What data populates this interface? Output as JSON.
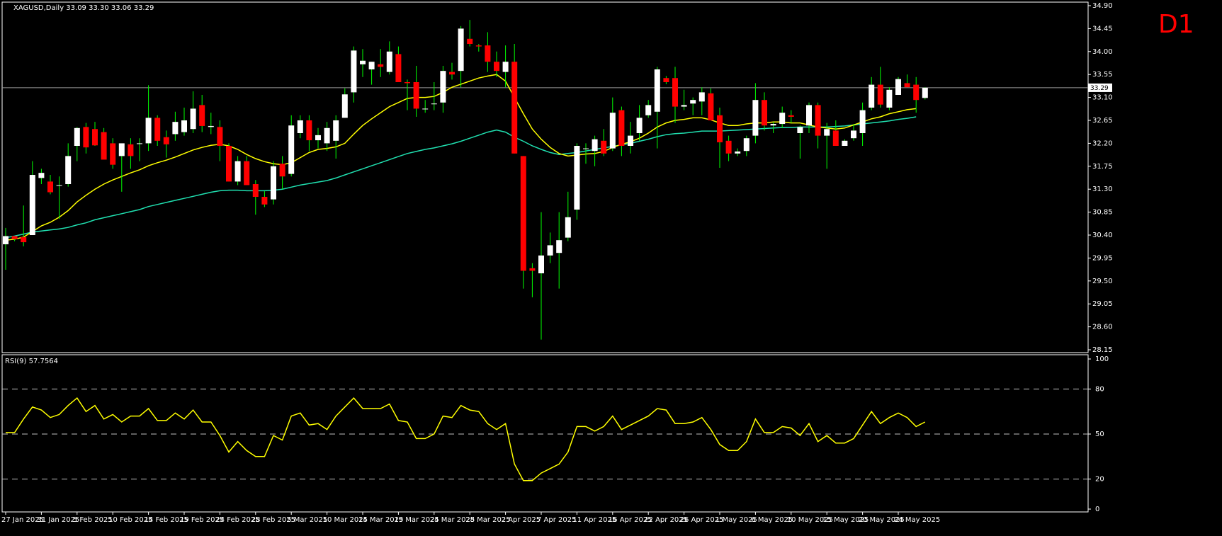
{
  "chart_data": [
    {
      "type": "candlestick",
      "symbol_line": "XAGUSD,Daily  33.09 33.30 33.06 33.29",
      "timeframe_label": "D1",
      "current_price_label": "33.29",
      "current_price": 33.29,
      "ylim": [
        28.15,
        34.9
      ],
      "y_ticks": [
        "34.90",
        "34.45",
        "34.00",
        "33.55",
        "33.10",
        "32.65",
        "32.20",
        "31.75",
        "31.30",
        "30.85",
        "30.40",
        "29.95",
        "29.50",
        "29.05",
        "28.60",
        "28.15"
      ],
      "x_ticks": [
        "27 Jan 2025",
        "31 Jan 2025",
        "5 Feb 2025",
        "10 Feb 2025",
        "14 Feb 2025",
        "19 Feb 2025",
        "24 Feb 2025",
        "28 Feb 2025",
        "5 Mar 2025",
        "10 Mar 2025",
        "14 Mar 2025",
        "19 Mar 2025",
        "24 Mar 2025",
        "28 Mar 2025",
        "2 Apr 2025",
        "7 Apr 2025",
        "11 Apr 2025",
        "16 Apr 2025",
        "22 Apr 2025",
        "26 Apr 2025",
        "1 May 2025",
        "6 May 2025",
        "10 May 2025",
        "15 May 2025",
        "20 May 2025",
        "24 May 2025"
      ],
      "colors": {
        "bull": "#ffffff",
        "bear": "#ff0000",
        "wick": "#00ff00",
        "ma_fast": "#ffff00",
        "ma_slow": "#20e0b0"
      },
      "candles": [
        [
          30.22,
          30.54,
          29.72,
          30.38
        ],
        [
          30.38,
          30.38,
          30.28,
          30.32
        ],
        [
          30.36,
          30.98,
          30.18,
          30.26
        ],
        [
          30.4,
          31.85,
          30.4,
          31.58
        ],
        [
          31.52,
          31.7,
          31.4,
          31.62
        ],
        [
          31.45,
          31.58,
          31.2,
          31.24
        ],
        [
          31.38,
          31.55,
          30.72,
          31.38
        ],
        [
          31.4,
          32.2,
          31.35,
          31.95
        ],
        [
          32.15,
          32.52,
          31.85,
          32.5
        ],
        [
          32.52,
          32.6,
          32.0,
          32.12
        ],
        [
          32.48,
          32.62,
          32.15,
          32.16
        ],
        [
          32.42,
          32.5,
          31.9,
          31.88
        ],
        [
          32.2,
          32.3,
          31.7,
          31.78
        ],
        [
          31.95,
          32.1,
          31.25,
          32.2
        ],
        [
          32.18,
          32.3,
          31.7,
          31.95
        ],
        [
          32.2,
          32.3,
          31.85,
          32.2
        ],
        [
          32.2,
          33.34,
          32.05,
          32.7
        ],
        [
          32.7,
          32.75,
          32.15,
          32.25
        ],
        [
          32.32,
          32.45,
          31.92,
          32.18
        ],
        [
          32.38,
          32.82,
          32.25,
          32.62
        ],
        [
          32.42,
          32.9,
          32.35,
          32.65
        ],
        [
          32.48,
          33.22,
          32.4,
          32.88
        ],
        [
          32.95,
          33.15,
          32.42,
          32.54
        ],
        [
          32.52,
          32.8,
          32.38,
          32.54
        ],
        [
          32.52,
          32.65,
          31.85,
          32.15
        ],
        [
          32.15,
          32.2,
          31.45,
          31.45
        ],
        [
          31.45,
          31.95,
          31.38,
          31.85
        ],
        [
          31.85,
          31.95,
          31.4,
          31.38
        ],
        [
          31.4,
          31.48,
          30.8,
          31.15
        ],
        [
          31.15,
          31.26,
          30.95,
          31.0
        ],
        [
          31.1,
          31.85,
          31.0,
          31.75
        ],
        [
          31.8,
          31.95,
          31.3,
          31.55
        ],
        [
          31.6,
          32.75,
          31.55,
          32.55
        ],
        [
          32.4,
          32.75,
          32.3,
          32.65
        ],
        [
          32.65,
          32.75,
          32.05,
          32.26
        ],
        [
          32.26,
          32.5,
          32.1,
          32.36
        ],
        [
          32.2,
          32.62,
          32.05,
          32.5
        ],
        [
          32.25,
          32.75,
          31.9,
          32.65
        ],
        [
          32.7,
          33.28,
          32.7,
          33.16
        ],
        [
          33.2,
          34.1,
          33.0,
          34.02
        ],
        [
          33.75,
          34.05,
          33.5,
          33.82
        ],
        [
          33.65,
          33.8,
          33.35,
          33.8
        ],
        [
          33.75,
          34.05,
          33.5,
          33.7
        ],
        [
          33.6,
          34.2,
          33.55,
          34.0
        ],
        [
          33.95,
          34.1,
          33.4,
          33.4
        ],
        [
          33.4,
          33.45,
          32.85,
          33.38
        ],
        [
          33.4,
          33.72,
          32.72,
          32.88
        ],
        [
          32.88,
          33.05,
          32.8,
          32.88
        ],
        [
          32.98,
          33.4,
          32.85,
          32.98
        ],
        [
          33.0,
          33.72,
          32.8,
          33.62
        ],
        [
          33.6,
          33.78,
          33.45,
          33.55
        ],
        [
          33.62,
          34.5,
          33.3,
          34.45
        ],
        [
          34.25,
          34.62,
          34.1,
          34.15
        ],
        [
          34.12,
          34.15,
          34.0,
          34.1
        ],
        [
          34.12,
          34.38,
          33.6,
          33.8
        ],
        [
          33.8,
          34.0,
          33.5,
          33.62
        ],
        [
          33.6,
          34.12,
          33.3,
          33.8
        ],
        [
          33.8,
          34.15,
          32.0,
          32.0
        ],
        [
          31.95,
          31.95,
          29.35,
          29.7
        ],
        [
          29.75,
          29.85,
          29.18,
          29.7
        ],
        [
          29.65,
          30.85,
          28.35,
          30.0
        ],
        [
          30.0,
          30.45,
          29.85,
          30.2
        ],
        [
          30.05,
          30.85,
          29.35,
          30.3
        ],
        [
          30.35,
          31.25,
          30.28,
          30.75
        ],
        [
          30.9,
          32.2,
          30.7,
          32.15
        ],
        [
          32.1,
          32.2,
          31.8,
          32.1
        ],
        [
          32.05,
          32.35,
          31.75,
          32.28
        ],
        [
          32.25,
          32.48,
          31.95,
          32.0
        ],
        [
          32.1,
          33.1,
          32.05,
          32.8
        ],
        [
          32.85,
          32.92,
          31.95,
          32.15
        ],
        [
          32.15,
          32.62,
          32.0,
          32.35
        ],
        [
          32.4,
          32.95,
          32.25,
          32.7
        ],
        [
          32.75,
          33.05,
          32.7,
          32.95
        ],
        [
          32.82,
          33.7,
          32.1,
          33.65
        ],
        [
          33.48,
          33.52,
          33.36,
          33.4
        ],
        [
          33.48,
          33.7,
          32.6,
          32.92
        ],
        [
          32.92,
          33.25,
          32.85,
          32.95
        ],
        [
          32.98,
          33.1,
          32.75,
          33.05
        ],
        [
          33.02,
          33.3,
          32.75,
          33.2
        ],
        [
          33.18,
          33.28,
          32.65,
          32.65
        ],
        [
          32.75,
          32.9,
          31.72,
          32.22
        ],
        [
          32.25,
          32.35,
          31.85,
          32.0
        ],
        [
          32.0,
          32.1,
          31.95,
          32.04
        ],
        [
          32.05,
          32.35,
          31.95,
          32.3
        ],
        [
          32.35,
          33.38,
          32.2,
          33.05
        ],
        [
          33.05,
          33.2,
          32.45,
          32.55
        ],
        [
          32.55,
          32.62,
          32.4,
          32.58
        ],
        [
          32.58,
          32.92,
          32.5,
          32.8
        ],
        [
          32.75,
          32.85,
          32.6,
          32.72
        ],
        [
          32.4,
          32.55,
          31.9,
          32.52
        ],
        [
          32.55,
          33.0,
          32.4,
          32.95
        ],
        [
          32.95,
          33.0,
          32.1,
          32.35
        ],
        [
          32.35,
          32.6,
          31.7,
          32.48
        ],
        [
          32.45,
          32.65,
          32.15,
          32.15
        ],
        [
          32.15,
          32.28,
          32.2,
          32.25
        ],
        [
          32.3,
          32.58,
          32.25,
          32.45
        ],
        [
          32.4,
          33.0,
          32.15,
          32.85
        ],
        [
          32.9,
          33.5,
          32.85,
          33.35
        ],
        [
          33.35,
          33.7,
          32.9,
          32.96
        ],
        [
          32.9,
          33.3,
          32.85,
          33.25
        ],
        [
          33.15,
          33.5,
          33.15,
          33.46
        ],
        [
          33.38,
          33.55,
          33.3,
          33.3
        ],
        [
          33.35,
          33.5,
          32.8,
          33.05
        ],
        [
          33.09,
          33.3,
          33.06,
          33.29
        ]
      ],
      "ma_fast": [
        30.3,
        30.32,
        30.36,
        30.47,
        30.58,
        30.65,
        30.75,
        30.88,
        31.05,
        31.18,
        31.3,
        31.4,
        31.48,
        31.55,
        31.62,
        31.68,
        31.76,
        31.82,
        31.87,
        31.93,
        32.0,
        32.07,
        32.12,
        32.16,
        32.18,
        32.15,
        32.08,
        31.98,
        31.9,
        31.84,
        31.8,
        31.78,
        31.82,
        31.92,
        32.02,
        32.08,
        32.1,
        32.13,
        32.2,
        32.38,
        32.55,
        32.68,
        32.8,
        32.92,
        33.0,
        33.08,
        33.1,
        33.1,
        33.12,
        33.2,
        33.3,
        33.36,
        33.42,
        33.48,
        33.52,
        33.55,
        33.42,
        33.1,
        32.78,
        32.48,
        32.28,
        32.12,
        32.0,
        31.95,
        31.97,
        31.99,
        32.0,
        32.04,
        32.12,
        32.18,
        32.23,
        32.3,
        32.4,
        32.52,
        32.6,
        32.65,
        32.67,
        32.7,
        32.7,
        32.66,
        32.6,
        32.55,
        32.55,
        32.58,
        32.6,
        32.6,
        32.62,
        32.62,
        32.6,
        32.6,
        32.56,
        32.52,
        32.5,
        32.48,
        32.5,
        32.56,
        32.62,
        32.68,
        32.72,
        32.78,
        32.82,
        32.86,
        32.88
      ],
      "ma_slow": [
        30.35,
        30.38,
        30.42,
        30.46,
        30.48,
        30.5,
        30.52,
        30.55,
        30.6,
        30.64,
        30.7,
        30.74,
        30.78,
        30.82,
        30.86,
        30.9,
        30.96,
        31.0,
        31.04,
        31.08,
        31.12,
        31.16,
        31.2,
        31.24,
        31.27,
        31.28,
        31.28,
        31.27,
        31.27,
        31.27,
        31.28,
        31.3,
        31.34,
        31.38,
        31.41,
        31.44,
        31.47,
        31.52,
        31.58,
        31.64,
        31.7,
        31.76,
        31.82,
        31.88,
        31.94,
        32.0,
        32.04,
        32.08,
        32.11,
        32.15,
        32.19,
        32.24,
        32.3,
        32.36,
        32.42,
        32.46,
        32.42,
        32.32,
        32.24,
        32.15,
        32.08,
        32.02,
        31.98,
        32.0,
        32.02,
        32.05,
        32.08,
        32.11,
        32.14,
        32.17,
        32.2,
        32.24,
        32.28,
        32.33,
        32.37,
        32.39,
        32.4,
        32.42,
        32.44,
        32.44,
        32.44,
        32.45,
        32.46,
        32.47,
        32.48,
        32.49,
        32.5,
        32.51,
        32.51,
        32.52,
        32.52,
        32.52,
        32.52,
        32.53,
        32.54,
        32.56,
        32.58,
        32.6,
        32.62,
        32.64,
        32.67,
        32.69,
        32.72
      ]
    },
    {
      "type": "line",
      "label": "RSI(9) 57.7564",
      "ylim": [
        0,
        100
      ],
      "y_ticks": [
        "100",
        "80",
        "50",
        "20",
        "0"
      ],
      "levels": [
        20,
        50,
        80
      ],
      "color": "#ffff00",
      "values": [
        51,
        51,
        60,
        68,
        66,
        61,
        63,
        69,
        74,
        65,
        69,
        60,
        63,
        58,
        62,
        62,
        67,
        59,
        59,
        64,
        60,
        66,
        58,
        58,
        49,
        38,
        45,
        39,
        35,
        35,
        49,
        46,
        62,
        64,
        56,
        57,
        53,
        62,
        68,
        74,
        67,
        67,
        67,
        70,
        59,
        58,
        47,
        47,
        50,
        62,
        61,
        69,
        66,
        65,
        57,
        53,
        57,
        30,
        19,
        19,
        24,
        27,
        30,
        38,
        55,
        55,
        52,
        55,
        62,
        53,
        56,
        59,
        62,
        67,
        66,
        57,
        57,
        58,
        61,
        53,
        43,
        39,
        39,
        45,
        60,
        51,
        51,
        55,
        54,
        49,
        57,
        45,
        49,
        44,
        44,
        47,
        56,
        65,
        57,
        61,
        64,
        61,
        55,
        58
      ]
    }
  ]
}
